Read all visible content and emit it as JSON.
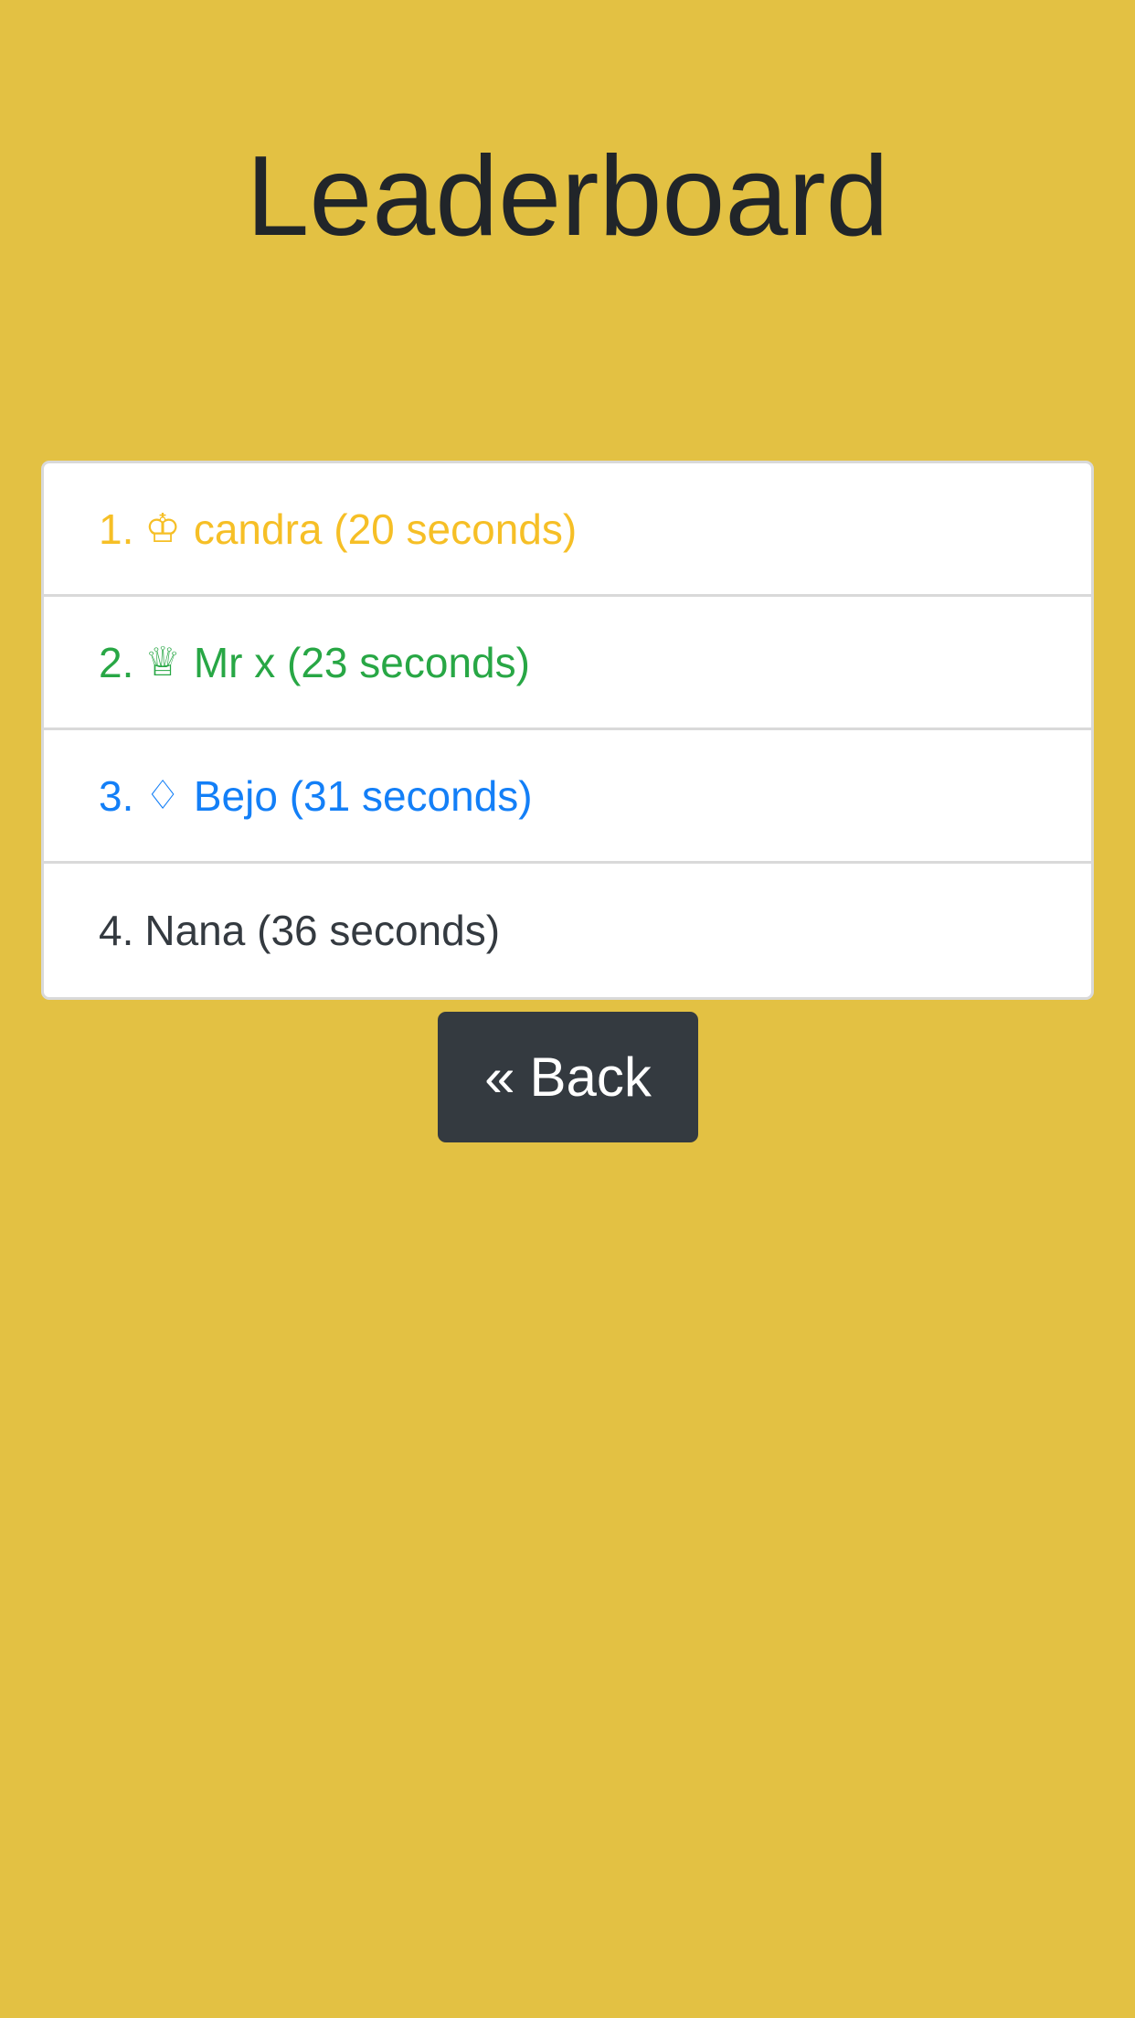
{
  "page": {
    "title": "Leaderboard"
  },
  "leaderboard": {
    "entries": [
      {
        "rank": "1.",
        "medal": "♔",
        "medal_icon": "king-crown-icon",
        "name": "candra",
        "time": "(20 seconds)",
        "color": "#f6bf26"
      },
      {
        "rank": "2.",
        "medal": "♕",
        "medal_icon": "queen-crown-icon",
        "name": "Mr x",
        "time": "(23 seconds)",
        "color": "#28a745"
      },
      {
        "rank": "3.",
        "medal": "♢",
        "medal_icon": "diamond-icon",
        "name": "Bejo",
        "time": "(31 seconds)",
        "color": "#137ff7"
      },
      {
        "rank": "4.",
        "name": "Nana",
        "time": "(36 seconds)",
        "color": "#343a40"
      }
    ]
  },
  "actions": {
    "back_arrow": "«",
    "back_label": "Back"
  },
  "colors": {
    "background": "#e3c143",
    "button": "#343a40"
  }
}
